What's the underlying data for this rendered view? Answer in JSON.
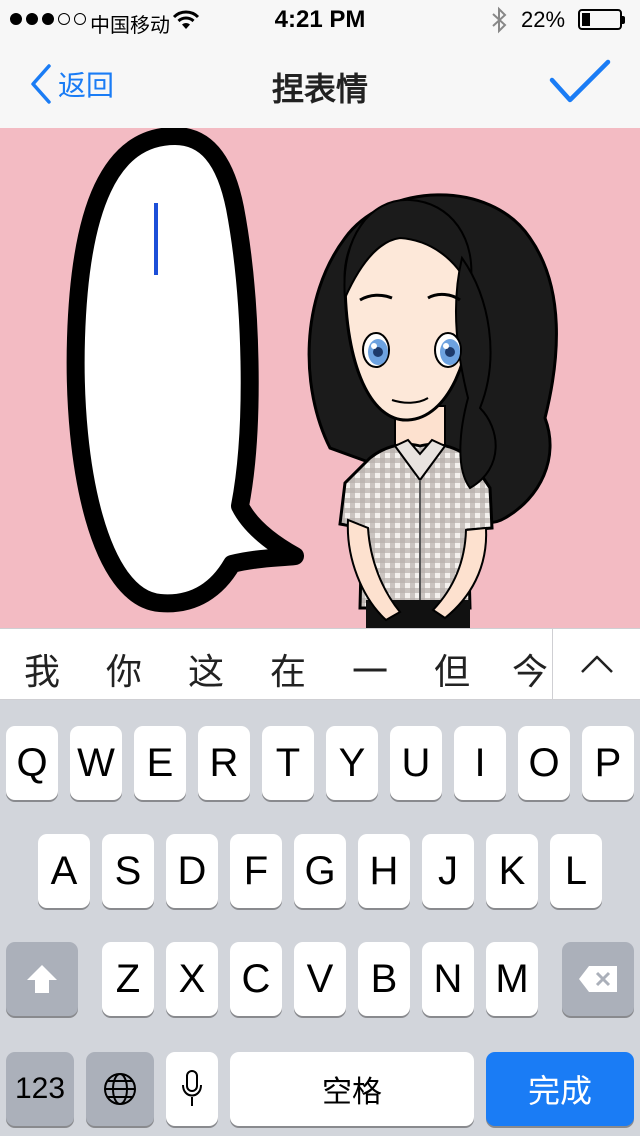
{
  "status": {
    "carrier": "中国移动",
    "time": "4:21 PM",
    "battery": "22%",
    "battery_level": 0.22
  },
  "nav": {
    "back_label": "返回",
    "title": "捏表情"
  },
  "suggestions": [
    "我",
    "你",
    "这",
    "在",
    "一",
    "但",
    "今"
  ],
  "keyboard": {
    "row1": [
      "Q",
      "W",
      "E",
      "R",
      "T",
      "Y",
      "U",
      "I",
      "O",
      "P"
    ],
    "row2": [
      "A",
      "S",
      "D",
      "F",
      "G",
      "H",
      "J",
      "K",
      "L"
    ],
    "row3": [
      "Z",
      "X",
      "C",
      "V",
      "B",
      "N",
      "M"
    ],
    "numbers_label": "123",
    "space_label": "空格",
    "done_label": "完成"
  },
  "colors": {
    "accent": "#1a7cf5",
    "stage_bg": "#f3bbc3",
    "keyboard_bg": "#d2d5db",
    "text_cursor": "#1c4fd8"
  }
}
